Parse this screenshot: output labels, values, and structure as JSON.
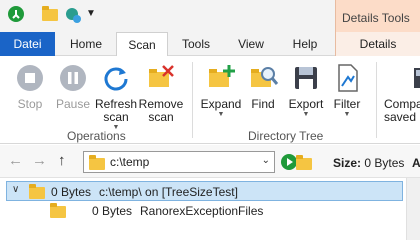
{
  "title_bar": {
    "context_header": "Details Tools",
    "qat_icons": [
      "treesize-logo-icon",
      "folder-icon",
      "globe-refresh-icon",
      "qat-dropdown-icon"
    ]
  },
  "tabs": [
    {
      "label": "Datei"
    },
    {
      "label": "Home"
    },
    {
      "label": "Scan",
      "active": true
    },
    {
      "label": "Tools"
    },
    {
      "label": "View"
    },
    {
      "label": "Help"
    },
    {
      "label": "Details"
    }
  ],
  "ribbon": {
    "operations": {
      "label": "Operations",
      "stop": "Stop",
      "pause": "Pause",
      "refresh_line1": "Refresh",
      "refresh_line2": "scan",
      "remove_line1": "Remove",
      "remove_line2": "scan"
    },
    "directory_tree": {
      "label": "Directory Tree",
      "expand": "Expand",
      "find": "Find",
      "export": "Export",
      "filter": "Filter"
    },
    "compare_line1": "Compa",
    "compare_line2": "saved"
  },
  "address_bar": {
    "path": "c:\\temp",
    "size_label": "Size:",
    "size_value": "0 Bytes",
    "extra": "A"
  },
  "tree": {
    "rows": [
      {
        "size": "0 Bytes",
        "name": "c:\\temp\\  on  [TreeSizeTest]",
        "selected": true,
        "expanded": true
      },
      {
        "size": "0 Bytes",
        "name": "RanorexExceptionFiles",
        "selected": false
      }
    ]
  },
  "colors": {
    "file_tab": "#1a64c7",
    "context_header": "#fcdcc8",
    "selection": "#cce4f7",
    "folder": "#f5c542",
    "go_button": "#1f9a3a"
  }
}
